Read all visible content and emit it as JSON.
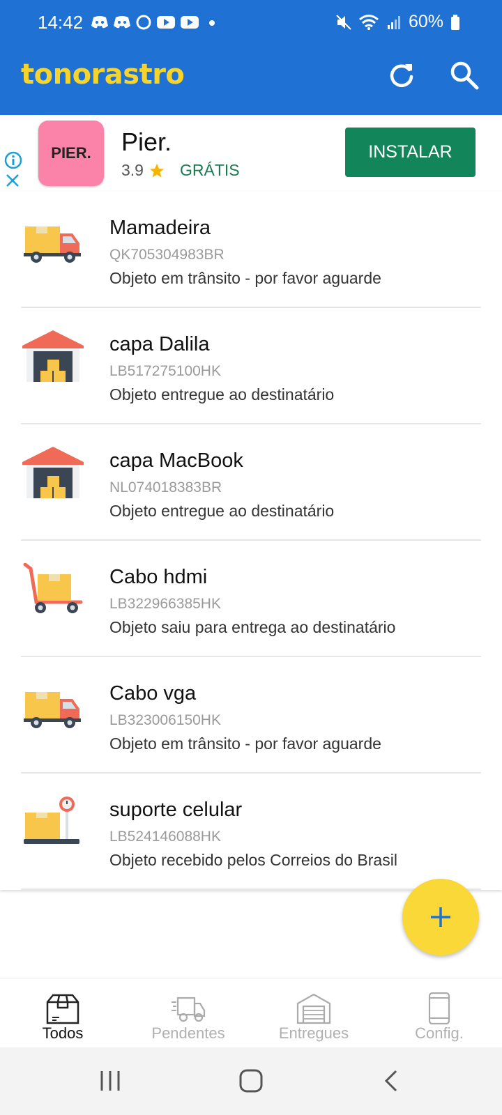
{
  "status_bar": {
    "time": "14:42",
    "battery": "60%",
    "icons": [
      "discord-icon",
      "discord-icon",
      "circle-app-icon",
      "youtube-icon",
      "youtube-icon",
      "dot-icon"
    ],
    "right_icons": [
      "mute-icon",
      "wifi-icon",
      "signal-icon",
      "battery-icon"
    ]
  },
  "app_bar": {
    "title": "tonorastro",
    "title_color": "#f7d32d",
    "background": "#1f72d3",
    "actions": [
      "refresh-icon",
      "search-icon"
    ]
  },
  "ad": {
    "logo_text": "PIER.",
    "title": "Pier.",
    "rating": "3.9",
    "price": "GRÁTIS",
    "install_label": "INSTALAR",
    "install_color": "#13855a"
  },
  "packages": [
    {
      "name": "Mamadeira",
      "code": "QK705304983BR",
      "status": "Objeto em trânsito - por favor aguarde",
      "icon": "truck-icon"
    },
    {
      "name": "capa Dalila",
      "code": "LB517275100HK",
      "status": "Objeto entregue ao destinatário",
      "icon": "warehouse-icon"
    },
    {
      "name": "capa MacBook",
      "code": "NL074018383BR",
      "status": "Objeto entregue ao destinatário",
      "icon": "warehouse-icon"
    },
    {
      "name": "Cabo hdmi",
      "code": "LB322966385HK",
      "status": "Objeto saiu para entrega ao destinatário",
      "icon": "hand-trolley-icon"
    },
    {
      "name": "Cabo vga",
      "code": "LB323006150HK",
      "status": "Objeto em trânsito - por favor aguarde",
      "icon": "truck-icon"
    },
    {
      "name": "suporte celular",
      "code": "LB524146088HK",
      "status": "Objeto recebido pelos Correios do Brasil",
      "icon": "scale-icon"
    }
  ],
  "fab": {
    "icon": "plus-icon",
    "color": "#f9d837"
  },
  "bottom_nav": [
    {
      "label": "Todos",
      "icon": "package-icon",
      "active": true
    },
    {
      "label": "Pendentes",
      "icon": "delivery-truck-icon",
      "active": false
    },
    {
      "label": "Entregues",
      "icon": "warehouse-outline-icon",
      "active": false
    },
    {
      "label": "Config.",
      "icon": "phone-icon",
      "active": false
    }
  ],
  "system_nav": [
    "recents-icon",
    "home-icon",
    "back-icon"
  ]
}
